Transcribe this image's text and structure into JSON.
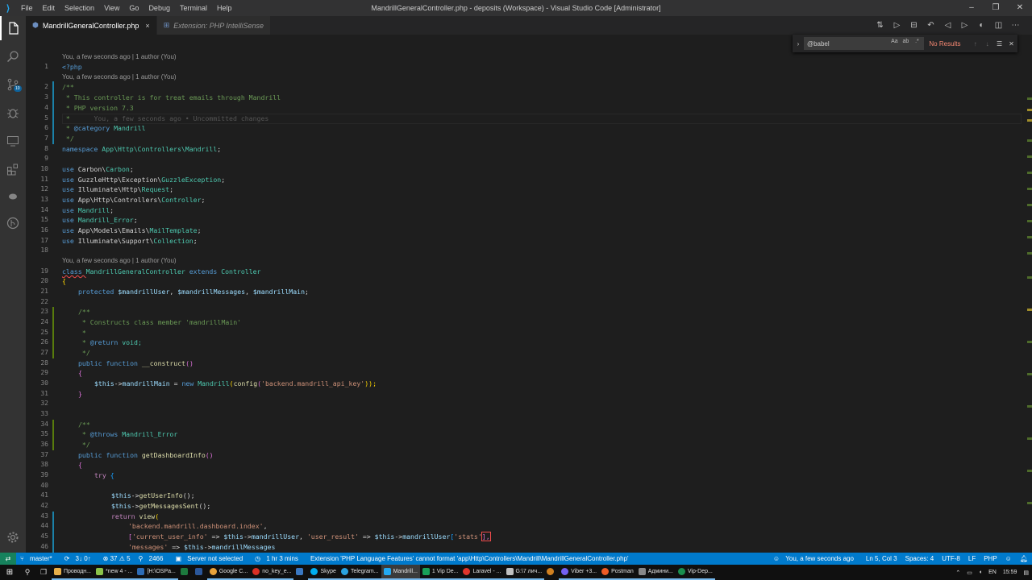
{
  "window": {
    "title": "MandrillGeneralController.php - deposits (Workspace) - Visual Studio Code [Administrator]",
    "menu": [
      "File",
      "Edit",
      "Selection",
      "View",
      "Go",
      "Debug",
      "Terminal",
      "Help"
    ],
    "controls": [
      "–",
      "❐",
      "✕"
    ]
  },
  "activity_bar": [
    {
      "name": "explorer-icon"
    },
    {
      "name": "search-icon"
    },
    {
      "name": "source-control-icon",
      "badge": "10"
    },
    {
      "name": "debug-icon"
    },
    {
      "name": "remote-explorer-icon"
    },
    {
      "name": "extensions-icon"
    },
    {
      "name": "docker-icon"
    },
    {
      "name": "gitlens-icon"
    },
    {
      "name": "settings-gear-icon"
    }
  ],
  "tabs": [
    {
      "label": "MandrillGeneralController.php",
      "active": true
    },
    {
      "label": "Extension: PHP IntelliSense",
      "active": false
    }
  ],
  "find": {
    "value": "@babel",
    "options": [
      "Aa",
      "ab",
      ".*"
    ],
    "result": "No Results"
  },
  "codelens": {
    "author": "You, a few seconds ago | 1 author (You)",
    "inline_blame": "You, a few seconds ago • Uncommitted changes"
  },
  "line_numbers": [
    "1",
    "2",
    "3",
    "4",
    "5",
    "6",
    "7",
    "8",
    "9",
    "10",
    "11",
    "12",
    "13",
    "14",
    "15",
    "16",
    "17",
    "18",
    "19",
    "20",
    "21",
    "22",
    "23",
    "24",
    "25",
    "26",
    "27",
    "28",
    "29",
    "30",
    "31",
    "32",
    "33",
    "34",
    "35",
    "36",
    "37",
    "38",
    "39",
    "40",
    "41",
    "42",
    "43",
    "44",
    "45",
    "46"
  ],
  "code": {
    "l1": "<?php",
    "l2": "/**",
    "l3": " * This controller is for treat emails through Mandrill",
    "l4": " * PHP version 7.3",
    "l5": " *",
    "l6a": " * ",
    "l6b": "@category",
    "l6c": " Mandrill",
    "l7": " */",
    "l8a": "namespace ",
    "l8b": "App\\Http\\Controllers\\Mandrill",
    "l8c": ";",
    "l10a": "use ",
    "l10b": "Carbon\\",
    "l10c": "Carbon",
    "l10d": ";",
    "l11a": "use ",
    "l11b": "GuzzleHttp\\Exception\\",
    "l11c": "GuzzleException",
    "l11d": ";",
    "l12a": "use ",
    "l12b": "Illuminate\\Http\\",
    "l12c": "Request",
    "l12d": ";",
    "l13a": "use ",
    "l13b": "App\\Http\\Controllers\\",
    "l13c": "Controller",
    "l13d": ";",
    "l14a": "use ",
    "l14c": "Mandrill",
    "l14d": ";",
    "l15a": "use ",
    "l15c": "Mandrill_Error",
    "l15d": ";",
    "l16a": "use ",
    "l16b": "App\\Models\\Emails\\",
    "l16c": "MailTemplate",
    "l16d": ";",
    "l17a": "use ",
    "l17b": "Illuminate\\Support\\",
    "l17c": "Collection",
    "l17d": ";",
    "l19a": "class ",
    "l19b": "MandrillGeneralController",
    "l19c": " extends ",
    "l19d": "Controller",
    "l20": "{",
    "l21a": "protected ",
    "l21b": "$mandrillUser",
    "l21c": ", ",
    "l21d": "$mandrillMessages",
    "l21e": ", ",
    "l21f": "$mandrillMain",
    "l21g": ";",
    "l23": "/**",
    "l24": " * Constructs class member 'mandrillMain'",
    "l25": " *",
    "l26a": " * ",
    "l26b": "@return",
    "l26c": " void;",
    "l27": " */",
    "l28a": "public function ",
    "l28b": "__construct",
    "l28c": "()",
    "l29": "{",
    "l30a": "$this",
    "l30b": "->",
    "l30c": "mandrillMain",
    "l30d": " = ",
    "l30e": "new ",
    "l30f": "Mandrill",
    "l30g": "(",
    "l30h": "config",
    "l30i": "(",
    "l30j": "'backend.mandrill_api_key'",
    "l30k": "));",
    "l31": "}",
    "l34": "/**",
    "l35a": " * ",
    "l35b": "@throws",
    "l35c": " Mandrill_Error",
    "l36": " */",
    "l37a": "public function ",
    "l37b": "getDashboardInfo",
    "l37c": "()",
    "l38": "{",
    "l39a": "try",
    "l39b": " {",
    "l41a": "$this",
    "l41b": "->",
    "l41c": "getUserInfo",
    "l41d": "();",
    "l42a": "$this",
    "l42b": "->",
    "l42c": "getMessagesSent",
    "l42d": "();",
    "l43a": "return ",
    "l43b": "view",
    "l43c": "(",
    "l44a": "'backend.mandrill.dashboard.index'",
    "l44b": ",",
    "l45a": "[",
    "l45b": "'current_user_info'",
    "l45c": " => ",
    "l45d": "$this",
    "l45e": "->",
    "l45f": "mandrillUser",
    "l45g": ", ",
    "l45h": "'user_result'",
    "l45i": " => ",
    "l45j": "$this",
    "l45k": "->",
    "l45l": "mandrillUser",
    "l45m": "[",
    "l45n": "'stats'",
    "l45o": "],",
    "l46a": "'messages'",
    "l46b": " => ",
    "l46c": "$this",
    "l46d": "->",
    "l46e": "mandrillMessages"
  },
  "status_bar": {
    "branch": "master*",
    "sync": "3↓ 0↑",
    "problems": "⊗ 37 ⚠ 5",
    "links": "2466",
    "server": "Server not selected",
    "time": "1 hr 3 mins",
    "message": "Extension 'PHP Language Features' cannot format 'app\\Http\\Controllers\\Mandrill\\MandrillGeneralController.php'",
    "blame": "You, a few seconds ago",
    "position": "Ln 5, Col 3",
    "spaces": "Spaces: 4",
    "encoding": "UTF-8",
    "eol": "LF",
    "language": "PHP"
  },
  "taskbar": {
    "items": [
      {
        "label": "Проводн...",
        "color": "#e8b04a"
      },
      {
        "label": "*new 4 - ...",
        "color": "#8bc34a"
      },
      {
        "label": "[H:\\OSPa...",
        "color": "#2d6cb5"
      },
      {
        "label": "",
        "color": "#1d7a3e"
      },
      {
        "label": "",
        "color": "#2b579a"
      },
      {
        "label": "Google C...",
        "color": "#e8a23a"
      },
      {
        "label": "no_key_e...",
        "color": "#d93025"
      },
      {
        "label": "",
        "color": "#3a78c2"
      },
      {
        "label": "Skype",
        "color": "#00aff0"
      },
      {
        "label": "Telegram...",
        "color": "#2aa3e0"
      },
      {
        "label": "Mandrill...",
        "color": "#23a9f2"
      },
      {
        "label": "1 Vip De...",
        "color": "#18a058"
      },
      {
        "label": "Laravel - ...",
        "color": "#e0352b"
      },
      {
        "label": "G:\\7 лич...",
        "color": "#c0c0c0"
      },
      {
        "label": "",
        "color": "#d08020"
      },
      {
        "label": "Viber +3...",
        "color": "#7360f2"
      },
      {
        "label": "Postman",
        "color": "#ef5b25"
      },
      {
        "label": "Админи...",
        "color": "#888888"
      },
      {
        "label": "Vip-Dep...",
        "color": "#1a8f4f"
      }
    ],
    "lang": "EN",
    "clock": "15:59"
  }
}
